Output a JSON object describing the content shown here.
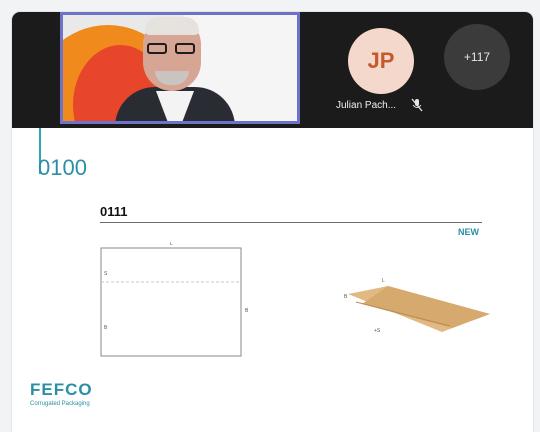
{
  "meeting": {
    "participant_initials": "JP",
    "participant_name": "Julian Pach...",
    "more_participants": "+117"
  },
  "document": {
    "code": "0100",
    "sub_code": "0111",
    "badge": "NEW",
    "logo": "FEFCO",
    "logo_sub": "Corrugated Packaging"
  },
  "colors": {
    "accent": "#2b8fa6",
    "video_border": "#6e73c9"
  },
  "icons": [
    "mic-off-icon"
  ]
}
